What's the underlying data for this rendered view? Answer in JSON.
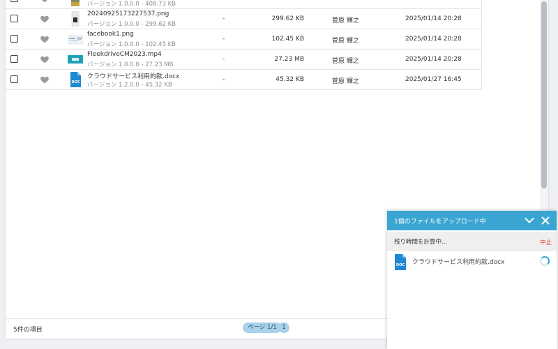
{
  "files": [
    {
      "name": "",
      "version": "バージョン 1.0.0.0 - 408.73 KB",
      "dash": "",
      "size": "",
      "owner": "",
      "date": "",
      "thumb": "image-thumbnail"
    },
    {
      "name": "20240925173227537.png",
      "version": "バージョン 1.0.0.0 - 299.62 KB",
      "dash": "-",
      "size": "299.62 KB",
      "owner": "菅原 輝之",
      "date": "2025/01/14 20:28",
      "thumb": "phone-image-thumbnail"
    },
    {
      "name": "facebook1.png",
      "version": "バージョン 1.0.0.0 - 102.45 KB",
      "dash": "-",
      "size": "102.45 KB",
      "owner": "菅原 輝之",
      "date": "2025/01/14 20:28",
      "thumb": "web-image-thumbnail"
    },
    {
      "name": "FleekdriveCM2023.mp4",
      "version": "バージョン 1.0.0.0 - 27.23 MB",
      "dash": "-",
      "size": "27.23 MB",
      "owner": "菅原 輝之",
      "date": "2025/01/14 20:28",
      "thumb": "video-thumbnail"
    },
    {
      "name": "クラウドサービス利用約款.docx",
      "version": "バージョン 1.2.0.0 - 45.32 KB",
      "dash": "-",
      "size": "45.32 KB",
      "owner": "菅原 輝之",
      "date": "2025/01/27 16:45",
      "thumb": "doc-file-icon"
    }
  ],
  "footer": {
    "item_count": "5件の項目",
    "page_label": "ページ 1/1",
    "page_number": "1"
  },
  "upload": {
    "title": "1個のファイルをアップロード中",
    "status": "残り時間を計算中...",
    "cancel": "中止",
    "file_name": "クラウドサービス利用約款.docx",
    "doc_badge": "DOC"
  },
  "colors": {
    "accent": "#3aa5d3",
    "cancel": "#e23b3b",
    "page_pill": "#a7d2ea",
    "doc_blue": "#1e88d2"
  }
}
